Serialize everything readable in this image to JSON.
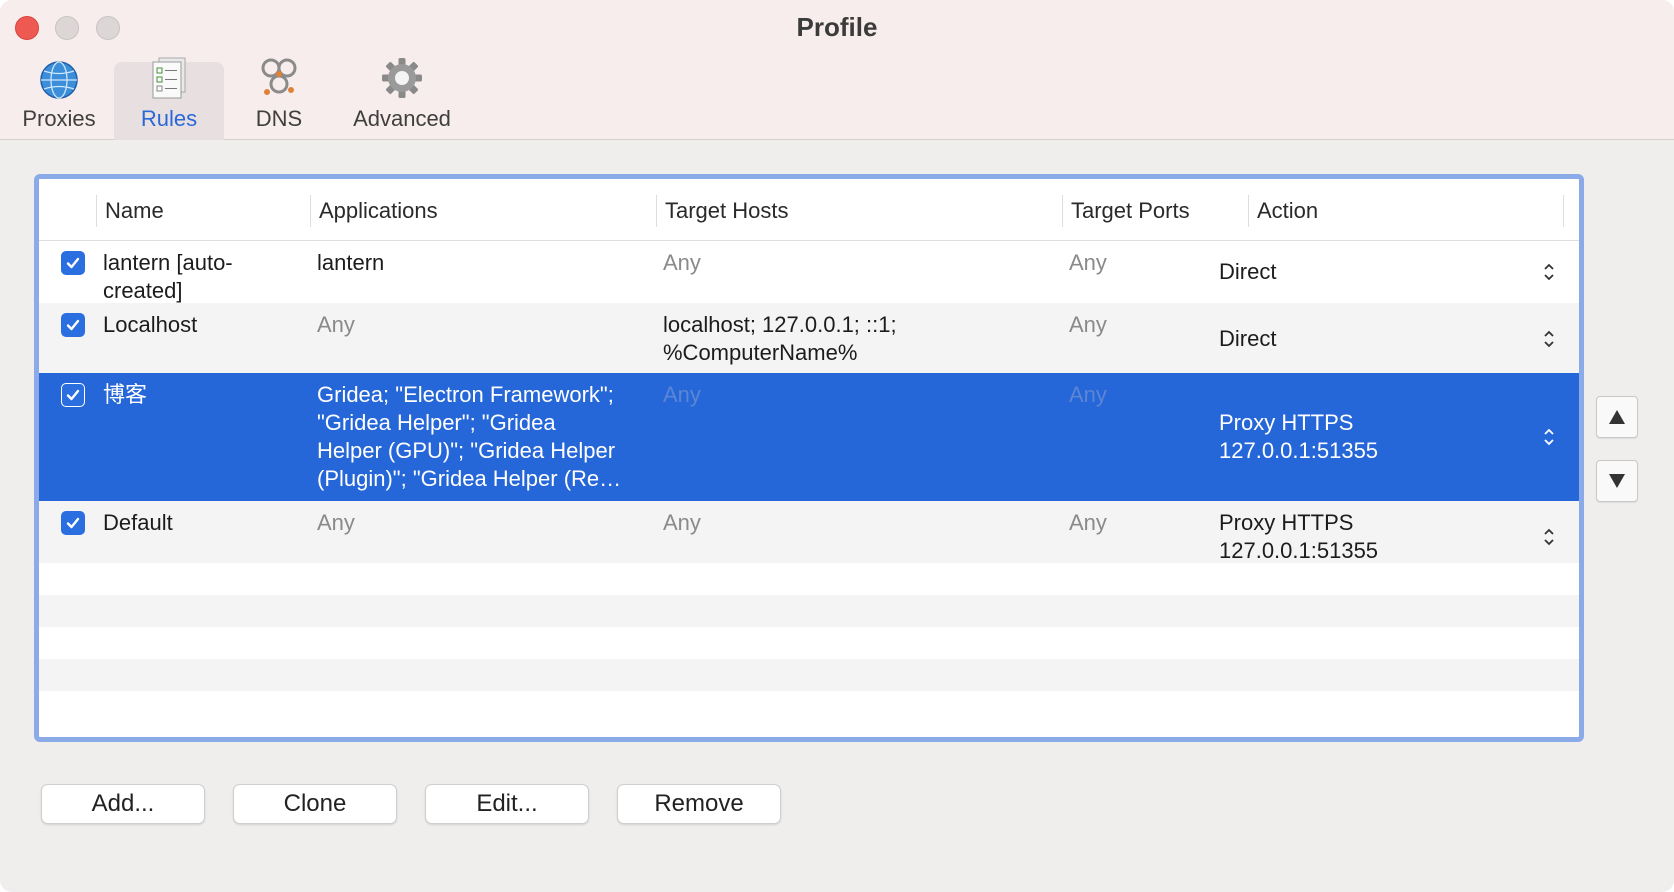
{
  "window": {
    "title": "Profile"
  },
  "tabs": [
    {
      "label": "Proxies",
      "icon": "globe-icon"
    },
    {
      "label": "Rules",
      "icon": "rules-list-icon",
      "active": true
    },
    {
      "label": "DNS",
      "icon": "dns-nodes-icon"
    },
    {
      "label": "Advanced",
      "icon": "gear-icon"
    }
  ],
  "table": {
    "columns": [
      "Name",
      "Applications",
      "Target Hosts",
      "Target Ports",
      "Action"
    ],
    "rows": [
      {
        "enabled": true,
        "name_line1": "lantern [auto-",
        "name_line2": "created]",
        "applications": "lantern",
        "target_hosts": "Any",
        "target_ports": "Any",
        "action": "Direct"
      },
      {
        "enabled": true,
        "name_line1": "Localhost",
        "applications": "Any",
        "target_hosts_line1": "localhost; 127.0.0.1; ::1;",
        "target_hosts_line2": "%ComputerName%",
        "target_ports": "Any",
        "action": "Direct"
      },
      {
        "enabled": true,
        "selected": true,
        "name_line1": "博客",
        "applications_lines": [
          "Gridea; \"Electron Framework\";",
          "\"Gridea Helper\"; \"Gridea",
          "Helper (GPU)\"; \"Gridea Helper",
          "(Plugin)\"; \"Gridea Helper (Re…"
        ],
        "target_hosts": "Any",
        "target_ports": "Any",
        "action_line1": "Proxy HTTPS",
        "action_line2": "127.0.0.1:51355"
      },
      {
        "enabled": true,
        "name_line1": "Default",
        "applications": "Any",
        "target_hosts": "Any",
        "target_ports": "Any",
        "action_line1": "Proxy HTTPS",
        "action_line2": "127.0.0.1:51355"
      }
    ]
  },
  "side_buttons": {
    "up_icon": "arrow-up-icon",
    "down_icon": "arrow-down-icon"
  },
  "buttons": {
    "add": "Add...",
    "clone": "Clone",
    "edit": "Edit...",
    "remove": "Remove"
  },
  "colors": {
    "accent": "#2566d8",
    "checkbox": "#2a6ee0",
    "close": "#ee5a52",
    "frame_focus": "#8aabe8"
  }
}
